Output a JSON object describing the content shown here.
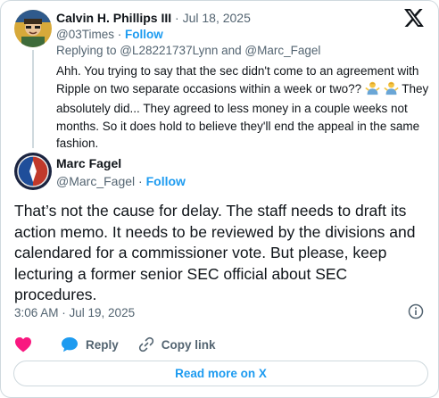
{
  "reply": {
    "author_name": "Calvin H. Phillips III",
    "separator": " · ",
    "date": "Jul 18, 2025",
    "handle": "@03Times",
    "follow_label": "Follow",
    "replying_prefix": "Replying to ",
    "replying_to_1": "@L28221737Lynn",
    "replying_and": " and ",
    "replying_to_2": "@Marc_Fagel",
    "text_part1": "Ahh. You trying to say that the sec didn't come to an agreement with Ripple on two separate occasions within a week or two??",
    "text_part2": "They absolutely did... They agreed to less money in a couple weeks not months. So it does hold to believe they'll end the appeal in the same fashion.",
    "emoji_icon": "person-shrugging-emoji"
  },
  "tweet": {
    "author_name": "Marc Fagel",
    "handle": "@Marc_Fagel",
    "follow_label": "Follow",
    "text": "That’s not the cause for delay. The staff needs to draft its action memo. It needs to be reviewed by the divisions and calendared for a commissioner vote. But please, keep lecturing a former senior SEC official about SEC procedures.",
    "timestamp": "3:06 AM · Jul 19, 2025"
  },
  "actions": {
    "reply_label": "Reply",
    "copy_link_label": "Copy link",
    "read_more_label": "Read more on X"
  },
  "colors": {
    "accent": "#1d9bf0",
    "heart": "#f91880",
    "text": "#0f1419",
    "muted": "#536471",
    "border": "#cfd9de"
  },
  "icons": [
    "x-logo-icon",
    "info-icon",
    "heart-icon",
    "reply-bubble-icon",
    "link-icon"
  ]
}
